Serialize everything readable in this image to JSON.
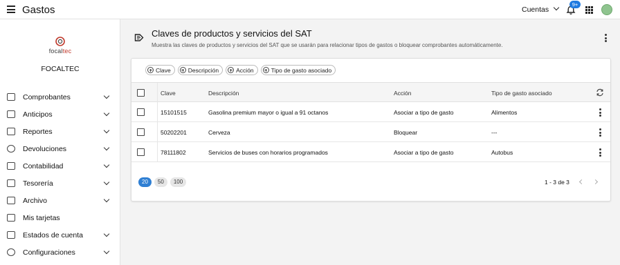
{
  "topbar": {
    "app_title": "Gastos",
    "accounts_label": "Cuentas",
    "notifications_badge": "9+"
  },
  "sidebar": {
    "logo_text_part1": "focal",
    "logo_text_part2": "tec",
    "company_name": "FOCALTEC",
    "items": [
      {
        "label": "Comprobantes",
        "icon": "receipt-icon",
        "expandable": true
      },
      {
        "label": "Anticipos",
        "icon": "wallet-icon",
        "expandable": true
      },
      {
        "label": "Reportes",
        "icon": "report-icon",
        "expandable": true
      },
      {
        "label": "Devoluciones",
        "icon": "refund-icon",
        "expandable": true
      },
      {
        "label": "Contabilidad",
        "icon": "bank-icon",
        "expandable": true
      },
      {
        "label": "Tesorería",
        "icon": "piggy-bank-icon",
        "expandable": true
      },
      {
        "label": "Archivo",
        "icon": "archive-icon",
        "expandable": true
      },
      {
        "label": "Mis tarjetas",
        "icon": "credit-card-icon",
        "expandable": false
      },
      {
        "label": "Estados de cuenta",
        "icon": "statement-icon",
        "expandable": true
      },
      {
        "label": "Configuraciones",
        "icon": "gear-icon",
        "expandable": true
      }
    ]
  },
  "header": {
    "title": "Claves de productos y servicios del SAT",
    "subtitle": "Muestra las claves de productos y servicios del SAT que se usarán para relacionar tipos de gastos o bloquear comprobantes automáticamente."
  },
  "filters": [
    "Clave",
    "Descripción",
    "Acción",
    "Tipo de gasto asociado"
  ],
  "table": {
    "columns": [
      "Clave",
      "Descripción",
      "Acción",
      "Tipo de gasto asociado"
    ],
    "rows": [
      {
        "clave": "15101515",
        "descripcion": "Gasolina premium mayor o igual a 91 octanos",
        "accion": "Asociar a tipo de gasto",
        "tipo": "Alimentos"
      },
      {
        "clave": "50202201",
        "descripcion": "Cerveza",
        "accion": "Bloquear",
        "tipo": "---"
      },
      {
        "clave": "78111802",
        "descripcion": "Servicios de buses con horarios programados",
        "accion": "Asociar a tipo de gasto",
        "tipo": "Autobus"
      }
    ]
  },
  "pagination": {
    "page_sizes": [
      "20",
      "50",
      "100"
    ],
    "selected_size": "20",
    "range_text": "1 - 3 de 3"
  },
  "colors": {
    "accent": "#2f7fd3",
    "badge": "#1f7ae0",
    "logo_red": "#c0392b"
  }
}
